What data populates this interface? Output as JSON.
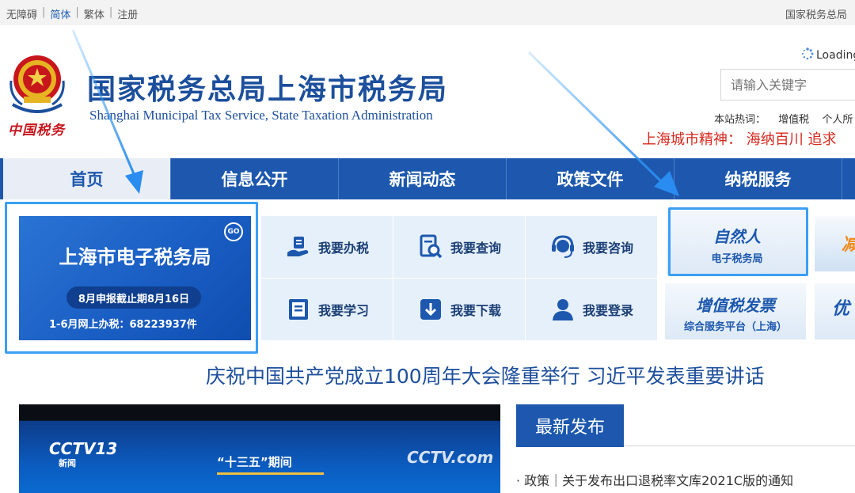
{
  "topbar": {
    "accessibility": "无障碍",
    "simplified": "简体",
    "traditional": "繁体",
    "register": "注册",
    "sep": "|",
    "right_link": "国家税务总局"
  },
  "header": {
    "emblem_text": "中国税务",
    "title": "国家税务总局上海市税务局",
    "subtitle": "Shanghai Municipal Tax Service, State Taxation Administration",
    "loading": "Loading",
    "search_placeholder": "请输入关键字",
    "hot_label": "本站热词：",
    "hot_words": [
      "增值税",
      "个人所"
    ],
    "spirit": "上海城市精神：  海纳百川 追求"
  },
  "nav": [
    {
      "label": "首页"
    },
    {
      "label": "信息公开"
    },
    {
      "label": "新闻动态"
    },
    {
      "label": "政策文件"
    },
    {
      "label": "纳税服务"
    }
  ],
  "etax": {
    "go": "GO",
    "title": "上海市电子税务局",
    "deadline": "8月申报截止期8月16日",
    "stats": "1-6月网上办税：68223937件"
  },
  "services": [
    {
      "label": "我要办税",
      "icon": "hand-document-icon"
    },
    {
      "label": "我要查询",
      "icon": "search-document-icon"
    },
    {
      "label": "我要咨询",
      "icon": "headset-icon"
    },
    {
      "label": "我要学习",
      "icon": "book-icon"
    },
    {
      "label": "我要下载",
      "icon": "download-icon"
    },
    {
      "label": "我要登录",
      "icon": "user-icon"
    }
  ],
  "tiles": {
    "natural_big": "自然人",
    "natural_small": "电子税务局",
    "invoice_big": "增值税发票",
    "invoice_small": "综合服务平台（上海）",
    "partial_top": "减",
    "partial_bottom": "优"
  },
  "headline": "庆祝中国共产党成立100周年大会隆重举行 习近平发表重要讲话",
  "video": {
    "channel": "CCTV13",
    "channel_sub": "新闻",
    "caption": "“十三五”期间",
    "logo_right": "CCTV.com"
  },
  "latest": {
    "tab": "最新发布",
    "item": "·  政策｜关于发布出口退税率文库2021C版的通知"
  },
  "colors": {
    "brand_blue": "#1d58ae",
    "title_blue": "#1c4f9c",
    "accent_red": "#d7281e",
    "annotation_blue": "#3a9ff5"
  }
}
